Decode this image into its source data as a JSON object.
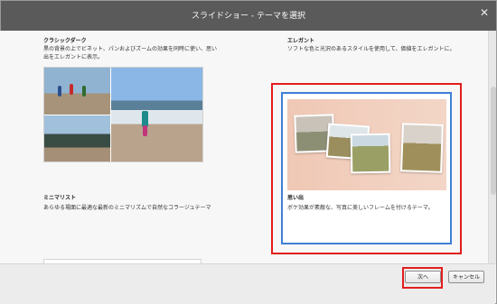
{
  "window": {
    "title": "スライドショー - テーマを選択",
    "close_icon": "close-icon"
  },
  "themes": [
    {
      "name": "クラシックダーク",
      "description": "黒の背景の上でビネット、パンおよびズームの効果を同時に使い、思い出をエレガントに表示。",
      "description_lines": [
        "黒の背景の上でビネット、パンおよびズームの効果を同時に使い、思い",
        "出をエレガントに表示。"
      ]
    },
    {
      "name": "エレガント",
      "description": "ソフトな色と光沢のあるスタイルを使用して、価値をエレガントに。",
      "description_lines": [
        "ソフトな色と光沢のあるスタイルを使用して、価値をエレガントに。"
      ]
    },
    {
      "name": "ミニマリスト",
      "description": "あらゆる場面に最適な最新のミニマリズムで自然なコラージュテーマ",
      "description_lines": [
        "あらゆる場面に最適な最新のミニマリズムで自然なコラージュテーマ"
      ]
    },
    {
      "name": "思い出",
      "description": "ボケ効果が素敵な、写真に美しいフレームを付けるテーマ。",
      "description_lines": [
        "ボケ効果が素敵な、写真に美しいフレームを付けるテーマ。"
      ],
      "selected": true
    }
  ],
  "footer": {
    "next_label": "次へ",
    "cancel_label": "キャンセル"
  },
  "colors": {
    "titlebar": "#5a5a5a",
    "selection_highlight": "#e21e1e",
    "selection_border": "#3f7fd6"
  }
}
